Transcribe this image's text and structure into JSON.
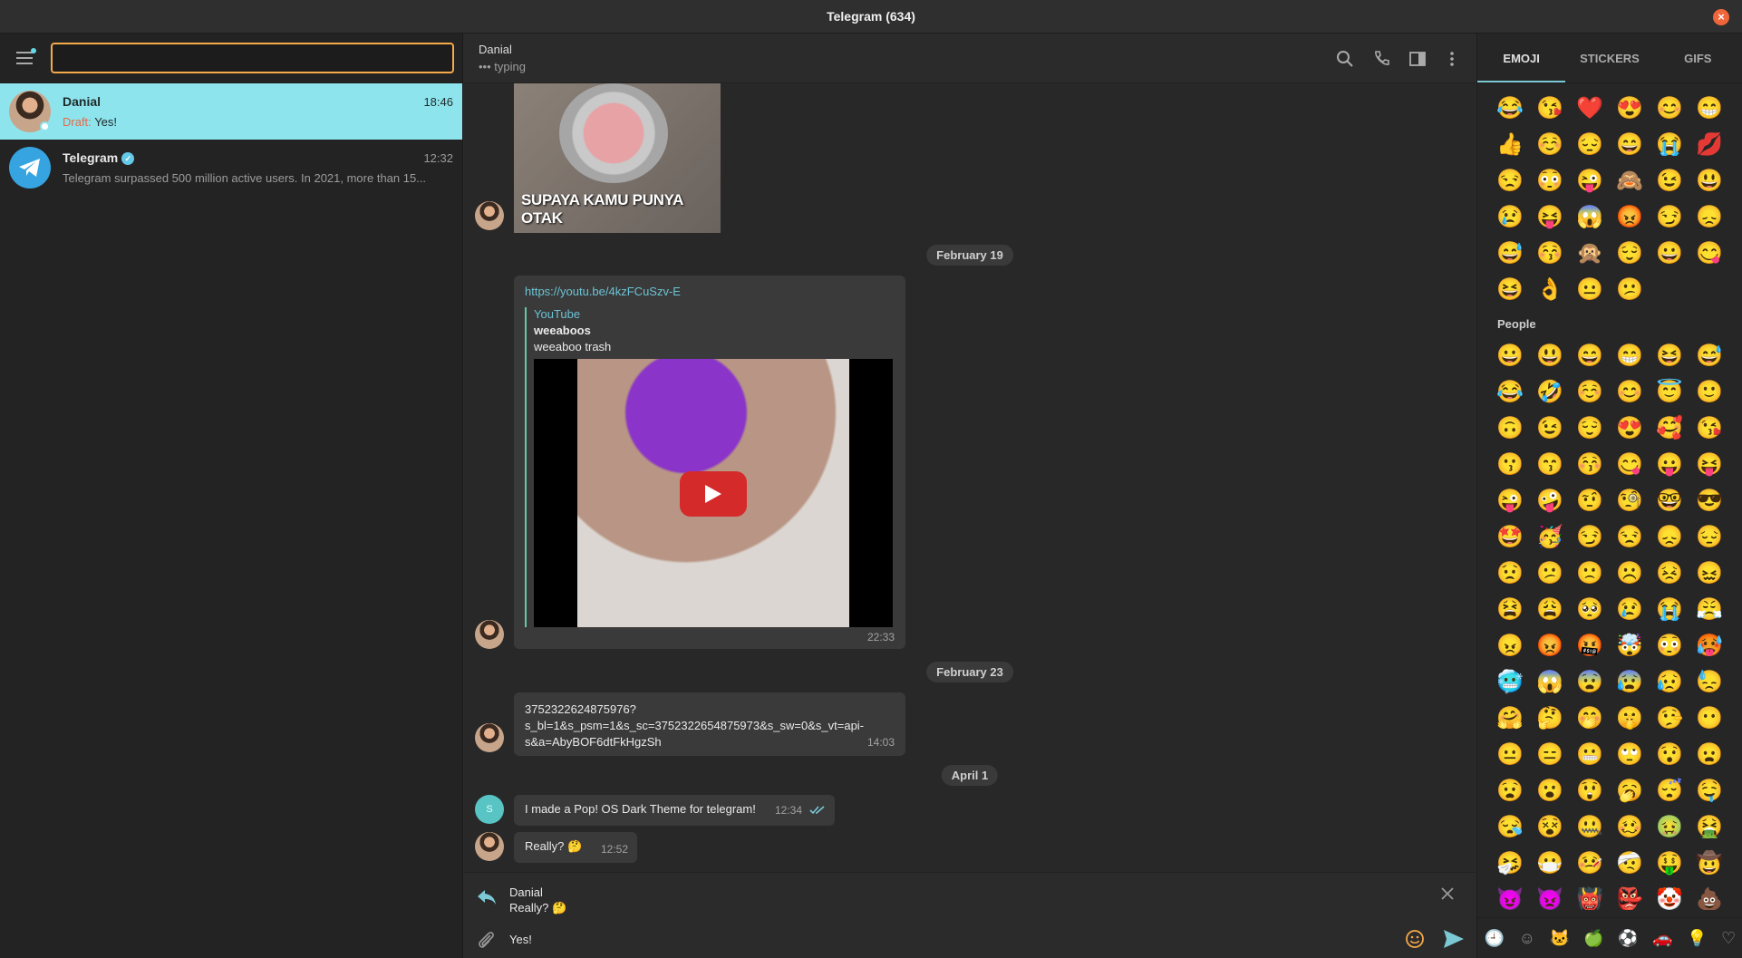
{
  "window": {
    "title": "Telegram (634)",
    "close_glyph": "×"
  },
  "search": {
    "placeholder": ""
  },
  "chats": [
    {
      "name": "Danial",
      "time": "18:46",
      "draft_label": "Draft:",
      "preview": "Yes!"
    },
    {
      "name": "Telegram",
      "time": "12:32",
      "preview": "Telegram surpassed 500 million active users.    In 2021, more than 15..."
    }
  ],
  "header": {
    "title": "Danial",
    "status": "••• typing"
  },
  "messages": {
    "image_caption": "SUPAYA KAMU PUNYA OTAK",
    "date1": "February 19",
    "link_url": "https://youtu.be/4kzFCuSzv-E",
    "link_site": "YouTube",
    "link_title": "weeaboos",
    "link_desc": "weeaboo trash",
    "link_time": "22:33",
    "date2": "February 23",
    "url_msg_line1": "3752322624875976?",
    "url_msg_line2": "s_bl=1&s_psm=1&s_sc=3752322654875973&s_sw=0&s_vt=api-",
    "url_msg_line3": "s&a=AbyBOF6dtFkHgzSh",
    "url_msg_time": "14:03",
    "date3": "April 1",
    "own_avatar_letter": "S",
    "own_msg": "I made a Pop! OS Dark Theme for telegram!",
    "own_time": "12:34",
    "reply_msg": "Really? 🤔",
    "reply_time": "12:52"
  },
  "compose": {
    "reply_to_name": "Danial",
    "reply_to_text": "Really? 🤔",
    "input_value": "Yes!"
  },
  "emoji_panel": {
    "tabs": [
      "EMOJI",
      "STICKERS",
      "GIFS"
    ],
    "recent": [
      "😂",
      "😘",
      "❤️",
      "😍",
      "😊",
      "😁",
      "👍",
      "☺️",
      "😔",
      "😄",
      "😭",
      "💋",
      "😒",
      "😳",
      "😜",
      "🙈",
      "😉",
      "😃",
      "😢",
      "😝",
      "😱",
      "😡",
      "😏",
      "😞",
      "😅",
      "😚",
      "🙊",
      "😌",
      "😀",
      "😋",
      "😆",
      "👌",
      "😐",
      "😕"
    ],
    "people_label": "People",
    "people": [
      "😀",
      "😃",
      "😄",
      "😁",
      "😆",
      "😅",
      "😂",
      "🤣",
      "☺️",
      "😊",
      "😇",
      "🙂",
      "🙃",
      "😉",
      "😌",
      "😍",
      "🥰",
      "😘",
      "😗",
      "😙",
      "😚",
      "😋",
      "😛",
      "😝",
      "😜",
      "🤪",
      "🤨",
      "🧐",
      "🤓",
      "😎",
      "🤩",
      "🥳",
      "😏",
      "😒",
      "😞",
      "😔",
      "😟",
      "😕",
      "🙁",
      "☹️",
      "😣",
      "😖",
      "😫",
      "😩",
      "🥺",
      "😢",
      "😭",
      "😤",
      "😠",
      "😡",
      "🤬",
      "🤯",
      "😳",
      "🥵",
      "🥶",
      "😱",
      "😨",
      "😰",
      "😥",
      "😓",
      "🤗",
      "🤔",
      "🤭",
      "🤫",
      "🤥",
      "😶",
      "😐",
      "😑",
      "😬",
      "🙄",
      "😯",
      "😦",
      "😧",
      "😮",
      "😲",
      "🥱",
      "😴",
      "🤤",
      "😪",
      "😵",
      "🤐",
      "🥴",
      "🤢",
      "🤮",
      "🤧",
      "😷",
      "🤒",
      "🤕",
      "🤑",
      "🤠",
      "😈",
      "👿",
      "👹",
      "👺",
      "🤡",
      "💩"
    ],
    "bottom_icons": [
      "🕘",
      "☺",
      "🐱",
      "🍏",
      "⚽",
      "🚗",
      "💡",
      "♡"
    ]
  },
  "colors": {
    "accent": "#8ee4ec",
    "search_border": "#f6a94a",
    "draft": "#e56a4a",
    "send": "#7cc9d6"
  }
}
